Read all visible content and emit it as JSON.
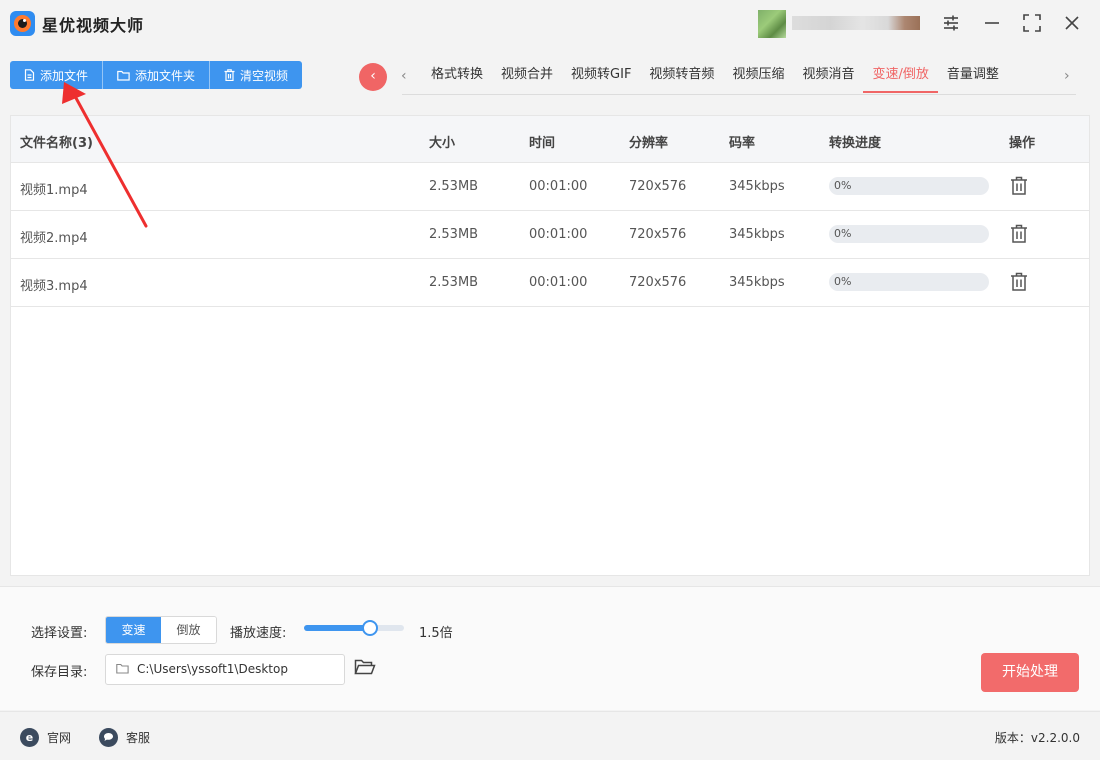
{
  "app": {
    "title": "星优视频大师"
  },
  "toolbar": {
    "add_file": "添加文件",
    "add_folder": "添加文件夹",
    "clear_videos": "清空视频"
  },
  "tabs": [
    {
      "label": "格式转换",
      "active": false
    },
    {
      "label": "视频合并",
      "active": false
    },
    {
      "label": "视频转GIF",
      "active": false
    },
    {
      "label": "视频转音频",
      "active": false
    },
    {
      "label": "视频压缩",
      "active": false
    },
    {
      "label": "视频消音",
      "active": false
    },
    {
      "label": "变速/倒放",
      "active": true
    },
    {
      "label": "音量调整",
      "active": false
    }
  ],
  "table": {
    "headers": {
      "name": "文件名称(3)",
      "size": "大小",
      "duration": "时间",
      "resolution": "分辨率",
      "bitrate": "码率",
      "progress": "转换进度",
      "actions": "操作"
    },
    "rows": [
      {
        "name": "视频1.mp4",
        "size": "2.53MB",
        "duration": "00:01:00",
        "resolution": "720x576",
        "bitrate": "345kbps",
        "progress_label": "0%",
        "progress": 0
      },
      {
        "name": "视频2.mp4",
        "size": "2.53MB",
        "duration": "00:01:00",
        "resolution": "720x576",
        "bitrate": "345kbps",
        "progress_label": "0%",
        "progress": 0
      },
      {
        "name": "视频3.mp4",
        "size": "2.53MB",
        "duration": "00:01:00",
        "resolution": "720x576",
        "bitrate": "345kbps",
        "progress_label": "0%",
        "progress": 0
      }
    ]
  },
  "settings": {
    "mode_label": "选择设置:",
    "mode_options": [
      "变速",
      "倒放"
    ],
    "mode_selected": "变速",
    "speed_label": "播放速度:",
    "speed_value": "1.5倍",
    "speed_fraction": 0.66,
    "save_label": "保存目录:",
    "save_path": "C:\\Users\\yssoft1\\Desktop",
    "start_button": "开始处理"
  },
  "statusbar": {
    "website": "官网",
    "support": "客服",
    "version": "版本：v2.2.0.0"
  },
  "colors": {
    "primary": "#3e95ef",
    "accent": "#f06565",
    "start_button": "#f26b6b"
  }
}
